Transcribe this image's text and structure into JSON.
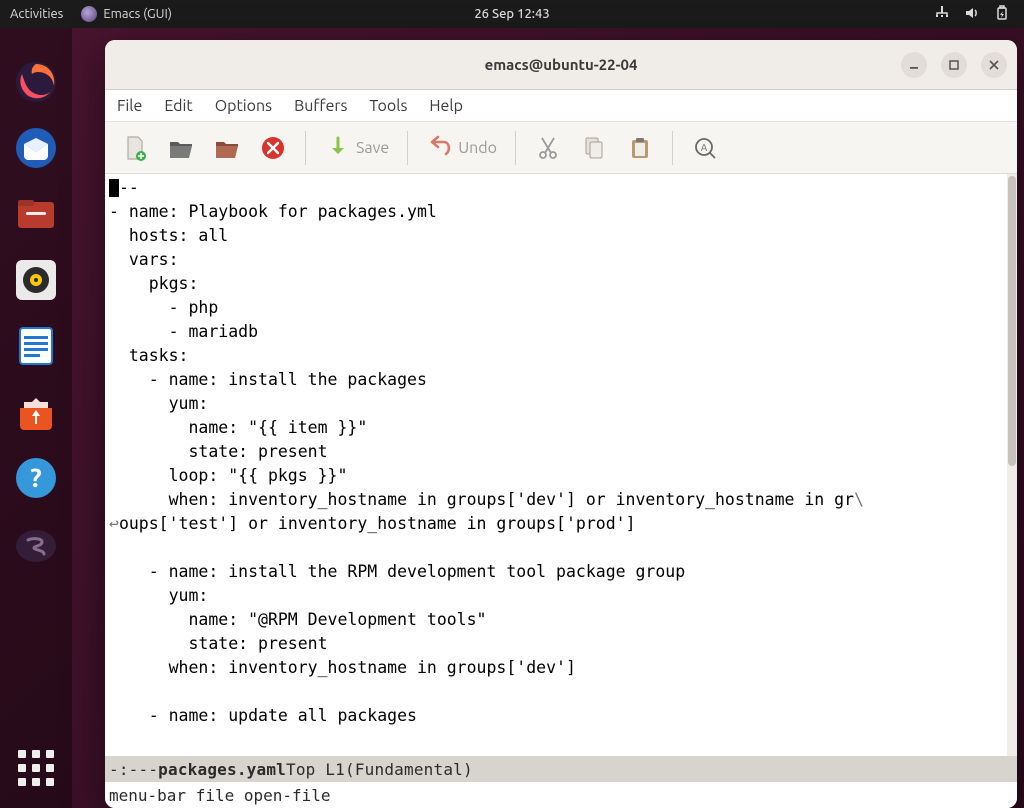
{
  "topbar": {
    "activities": "Activities",
    "app_name": "Emacs (GUI)",
    "datetime": "26 Sep  12:43"
  },
  "window": {
    "title": "emacs@ubuntu-22-04"
  },
  "menubar": {
    "items": [
      "File",
      "Edit",
      "Options",
      "Buffers",
      "Tools",
      "Help"
    ]
  },
  "toolbar": {
    "save_label": "Save",
    "undo_label": "Undo"
  },
  "buffer": {
    "lines": [
      "---",
      "- name: Playbook for packages.yml",
      "  hosts: all",
      "  vars:",
      "    pkgs:",
      "      - php",
      "      - mariadb",
      "  tasks:",
      "    - name: install the packages",
      "      yum:",
      "        name: \"{{ item }}\"",
      "        state: present",
      "      loop: \"{{ pkgs }}\"",
      "      when: inventory_hostname in groups['dev'] or inventory_hostname in gr",
      "oups['test'] or inventory_hostname in groups['prod']",
      "",
      "    - name: install the RPM development tool package group",
      "      yum:",
      "        name: \"@RPM Development tools\"",
      "        state: present",
      "      when: inventory_hostname in groups['dev']",
      "",
      "    - name: update all packages"
    ]
  },
  "modeline": {
    "left": " -:--- ",
    "filename": "packages.yaml",
    "pad1": "   ",
    "position": "Top L1",
    "pad2": "     ",
    "mode": "(Fundamental)"
  },
  "minibuffer": {
    "text": "menu-bar file open-file"
  }
}
